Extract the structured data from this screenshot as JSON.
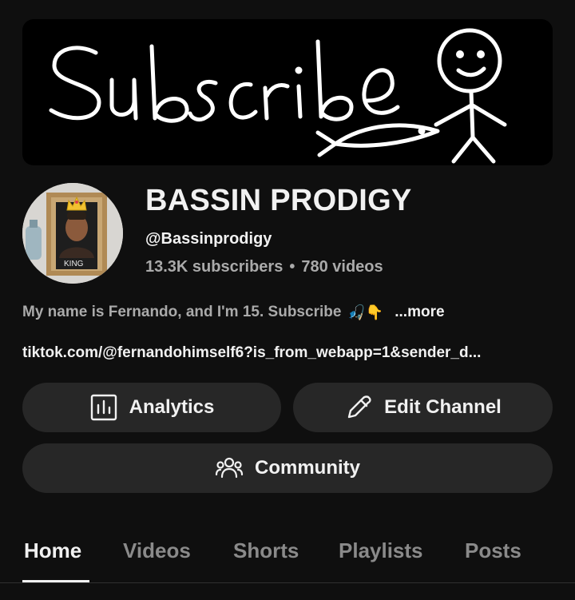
{
  "banner": {
    "text": "Subscribe",
    "icon": "stick-figure-with-fish-drawing"
  },
  "avatar": {
    "icon": "framed-portrait-with-crown",
    "frame_label": "KING"
  },
  "channel": {
    "name": "BASSIN PRODIGY",
    "handle": "@Bassinprodigy",
    "subscribers": "13.3K subscribers",
    "separator": "•",
    "videos": "780 videos"
  },
  "description": {
    "text": "My name is Fernando, and I'm 15. Subscribe",
    "emoji": "🎣👇",
    "more_label": "...more"
  },
  "link": {
    "text": "tiktok.com/@fernandohimself6?is_from_webapp=1&sender_d..."
  },
  "buttons": {
    "analytics_label": "Analytics",
    "analytics_icon": "bar-chart-icon",
    "edit_label": "Edit Channel",
    "edit_icon": "pencil-icon",
    "community_label": "Community",
    "community_icon": "people-icon"
  },
  "tabs": [
    {
      "label": "Home",
      "active": true
    },
    {
      "label": "Videos",
      "active": false
    },
    {
      "label": "Shorts",
      "active": false
    },
    {
      "label": "Playlists",
      "active": false
    },
    {
      "label": "Posts",
      "active": false
    }
  ],
  "colors": {
    "background": "#0f0f0f",
    "button": "#272727",
    "primary_text": "#f1f1f1",
    "secondary_text": "#aaaaaa",
    "inactive_tab": "#8a8a8a"
  }
}
